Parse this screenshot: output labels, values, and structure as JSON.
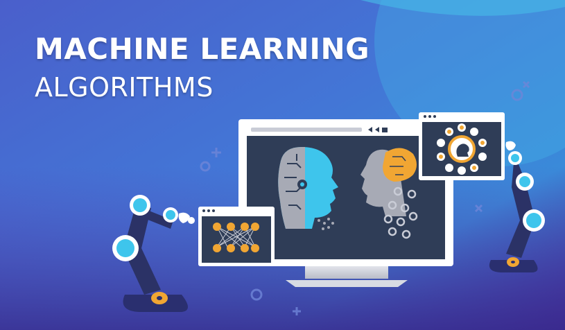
{
  "headline": {
    "line1": "MACHINE LEARNING",
    "line2": "ALGORITHMS"
  },
  "colors": {
    "background_top": "#3b7fd4",
    "background_bottom": "#3f2c93",
    "screen": "#2e3d55",
    "accent_cyan": "#3ec5ec",
    "accent_orange": "#f1a633",
    "gray_head": "#a7aab5"
  },
  "icons": [
    "monitor-icon",
    "robot-arm-icon",
    "neural-network-icon",
    "brain-gears-icon",
    "ai-head-icon"
  ]
}
